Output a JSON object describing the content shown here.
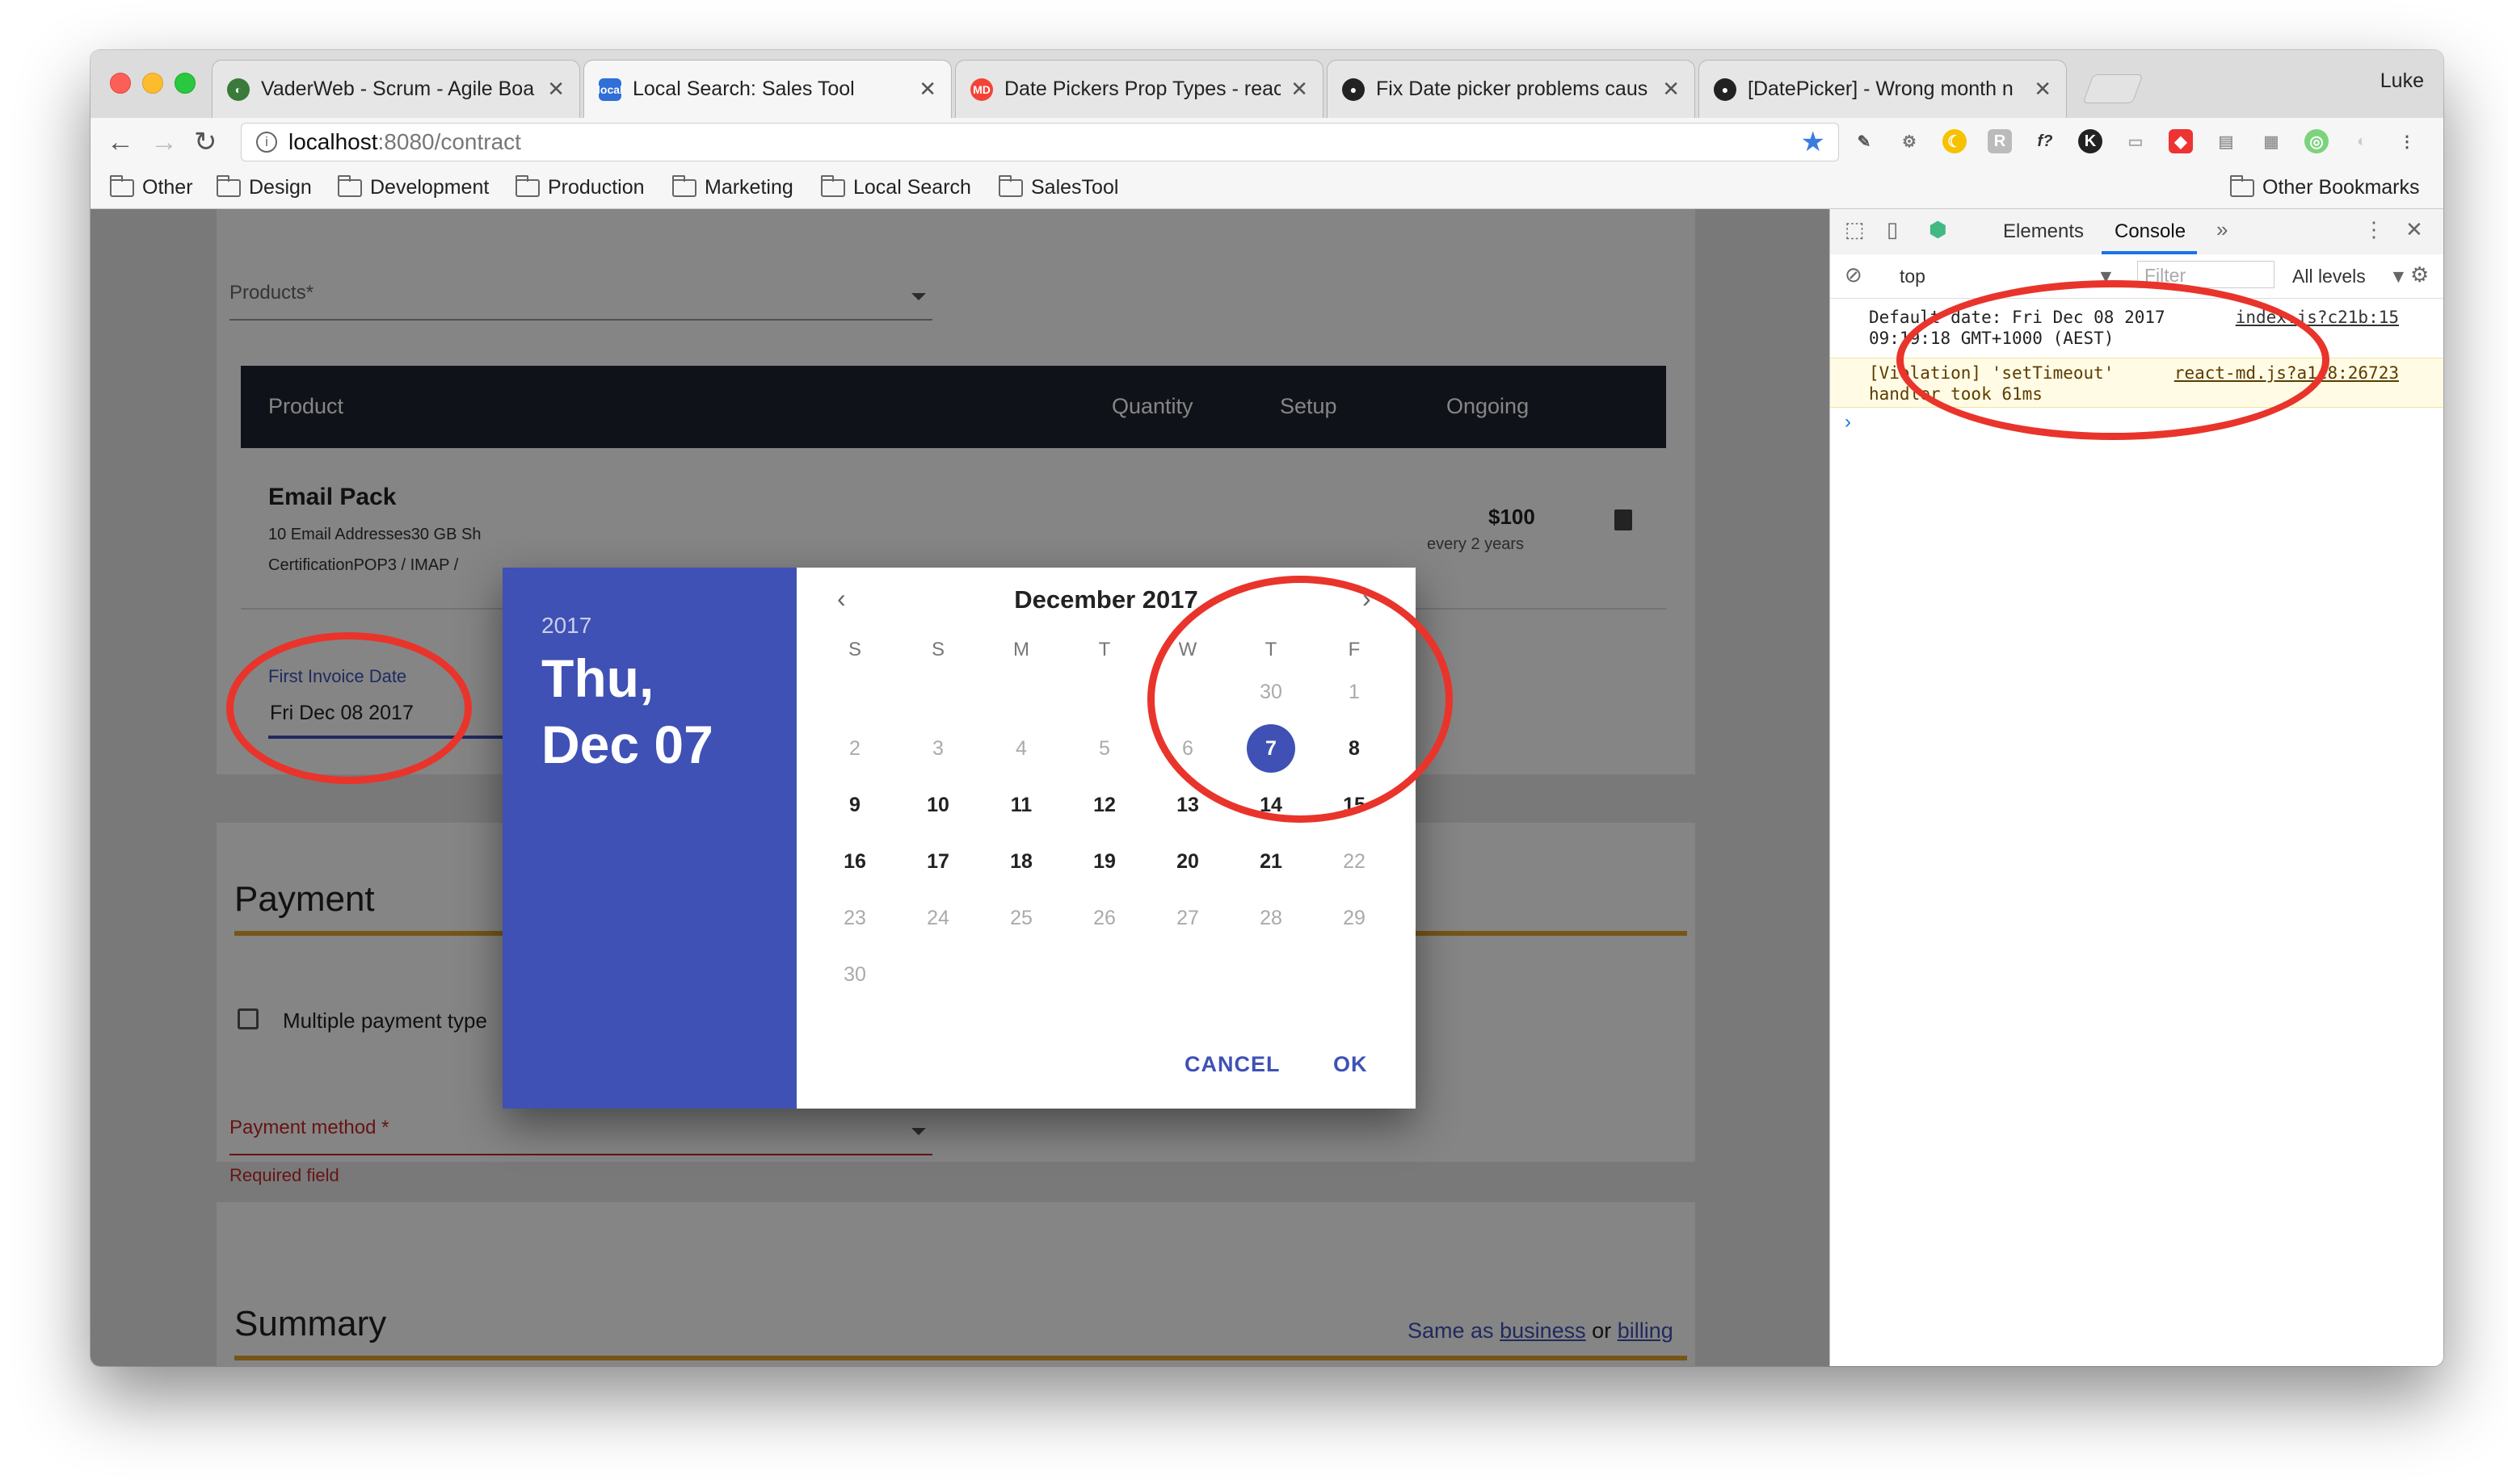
{
  "browser": {
    "tabs": [
      {
        "title": "VaderWeb - Scrum - Agile Boa",
        "active": false
      },
      {
        "title": "Local Search: Sales Tool",
        "active": true
      },
      {
        "title": "Date Pickers Prop Types - reac",
        "active": false
      },
      {
        "title": "Fix Date picker problems caus",
        "active": false
      },
      {
        "title": "[DatePicker] - Wrong month n",
        "active": false
      }
    ],
    "profile": "Luke",
    "address": {
      "host": "localhost",
      "path": ":8080/contract"
    },
    "bookmarks": [
      "Other",
      "Design",
      "Development",
      "Production",
      "Marketing",
      "Local Search",
      "SalesTool"
    ],
    "other_bookmarks": "Other Bookmarks"
  },
  "form": {
    "products_label": "Products*",
    "table_headers": {
      "product": "Product",
      "quantity": "Quantity",
      "setup": "Setup",
      "ongoing": "Ongoing"
    },
    "row": {
      "name": "Email Pack",
      "desc1": "10 Email Addresses30 GB Sh",
      "desc2": "CertificationPOP3 / IMAP /",
      "price": "$100",
      "period": "every 2 years"
    },
    "invoice_label": "First Invoice Date",
    "invoice_value": "Fri Dec 08 2017",
    "payment_heading": "Payment",
    "multiple_payment_label": "Multiple payment type",
    "payment_method_label": "Payment method *",
    "required_text": "Required field",
    "summary_heading": "Summary",
    "same_as_prefix": "Same as",
    "same_as_business": "business",
    "same_as_or": "or",
    "same_as_billing": "billing"
  },
  "datepicker": {
    "year": "2017",
    "weekday": "Thu,",
    "monthday": "Dec 07",
    "month_title": "December 2017",
    "weekdays": [
      "S",
      "S",
      "M",
      "T",
      "W",
      "T",
      "F"
    ],
    "weeks": [
      [
        "",
        "",
        "",
        "",
        "",
        "30",
        "1"
      ],
      [
        "2",
        "3",
        "4",
        "5",
        "6",
        "7",
        "8"
      ],
      [
        "9",
        "10",
        "11",
        "12",
        "13",
        "14",
        "15"
      ],
      [
        "16",
        "17",
        "18",
        "19",
        "20",
        "21",
        "22"
      ],
      [
        "23",
        "24",
        "25",
        "26",
        "27",
        "28",
        "29"
      ],
      [
        "30",
        "",
        "",
        "",
        "",
        "",
        ""
      ]
    ],
    "selected": "7",
    "cancel": "CANCEL",
    "ok": "OK"
  },
  "devtools": {
    "tabs": [
      "Elements",
      "Console"
    ],
    "context": "top",
    "filter_placeholder": "Filter",
    "levels": "All levels",
    "log1": "Default date:  Fri Dec 08 2017",
    "log1_line2": "09:19:18 GMT+1000 (AEST)",
    "log1_src": "index.js?c21b:15",
    "log2": "[Violation] 'setTimeout'",
    "log2_line2": "handler took 61ms",
    "log2_src": "react-md.js?a1c8:26723"
  },
  "colors": {
    "accent": "#3f51b5",
    "annotation": "#e9342b",
    "gold": "#e3a52b",
    "error": "#c62828"
  }
}
